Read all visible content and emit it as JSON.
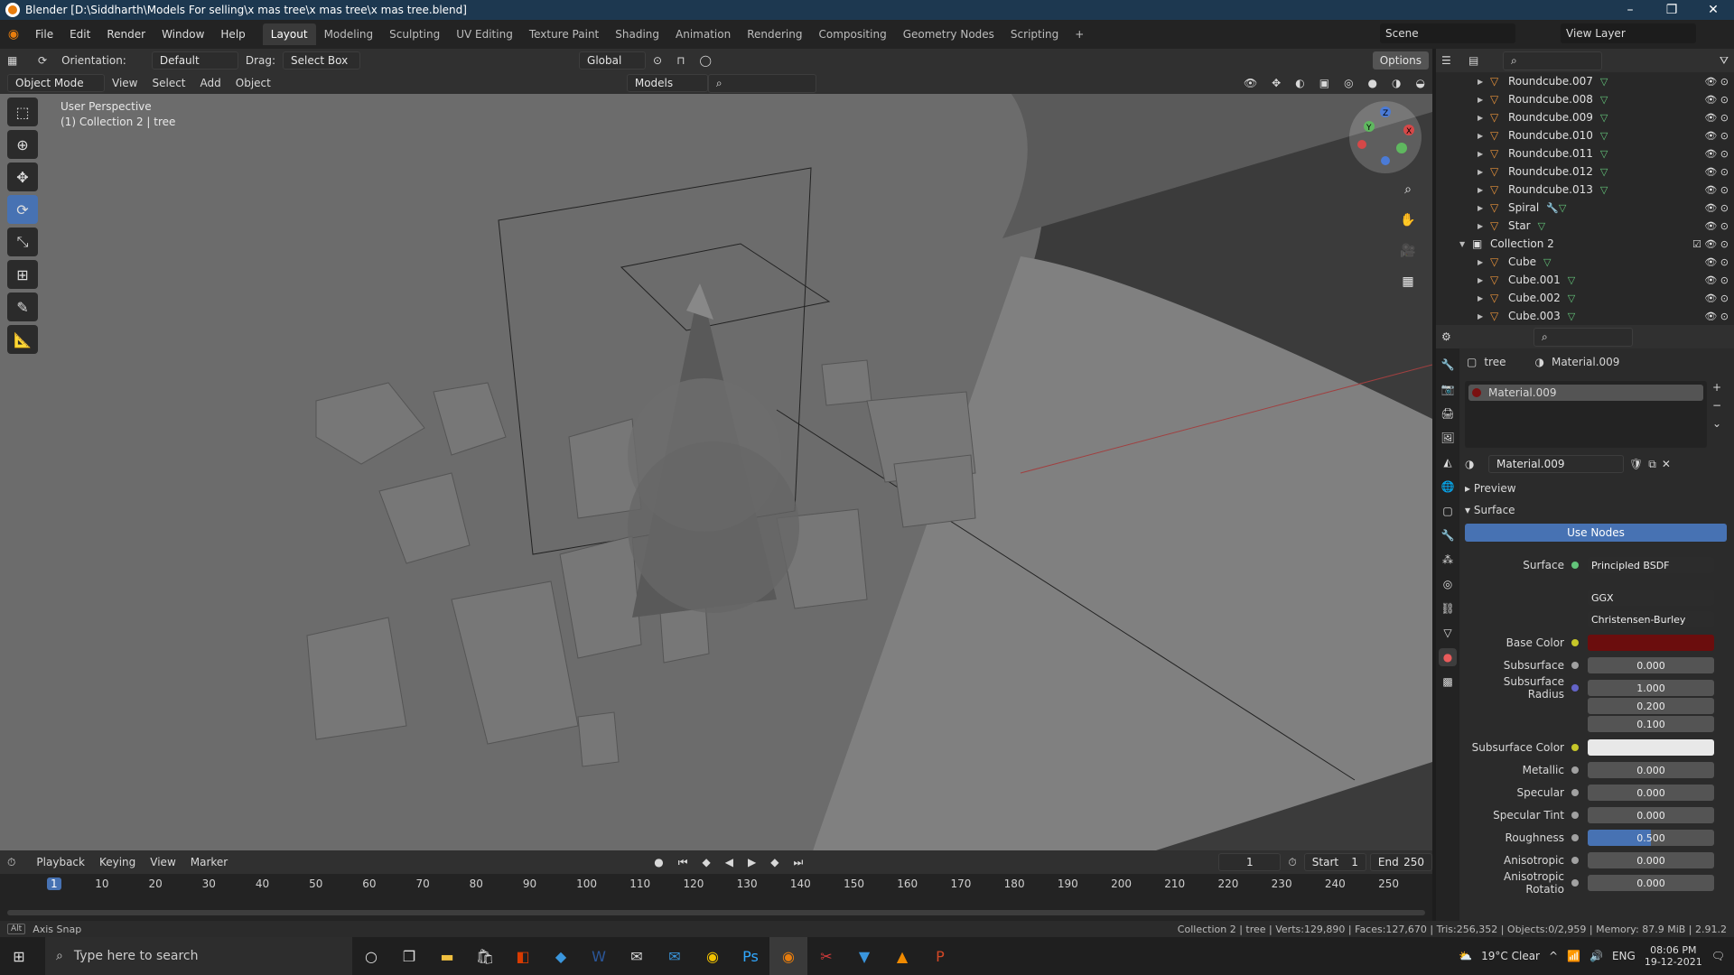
{
  "window": {
    "title": "Blender [D:\\Siddharth\\Models For selling\\x mas tree\\x mas tree\\x mas tree.blend]"
  },
  "menu": [
    "File",
    "Edit",
    "Render",
    "Window",
    "Help"
  ],
  "workspaces": [
    "Layout",
    "Modeling",
    "Sculpting",
    "UV Editing",
    "Texture Paint",
    "Shading",
    "Animation",
    "Rendering",
    "Compositing",
    "Geometry Nodes",
    "Scripting"
  ],
  "active_workspace": "Layout",
  "scene": {
    "label": "Scene",
    "view_layer": "View Layer"
  },
  "header": {
    "orientation_label": "Orientation:",
    "orientation_value": "Default",
    "drag_label": "Drag:",
    "drag_value": "Select Box",
    "transform_space": "Global",
    "options": "Options"
  },
  "header2": {
    "mode": "Object Mode",
    "view": "View",
    "select": "Select",
    "add": "Add",
    "object": "Object",
    "collection_filter": "Models"
  },
  "viewport": {
    "line1": "User Perspective",
    "line2": "(1) Collection 2 | tree"
  },
  "outliner": {
    "items": [
      {
        "name": "Roundcube.007"
      },
      {
        "name": "Roundcube.008"
      },
      {
        "name": "Roundcube.009"
      },
      {
        "name": "Roundcube.010"
      },
      {
        "name": "Roundcube.011"
      },
      {
        "name": "Roundcube.012"
      },
      {
        "name": "Roundcube.013"
      },
      {
        "name": "Spiral"
      },
      {
        "name": "Star"
      },
      {
        "name": "Collection 2"
      },
      {
        "name": "Cube"
      },
      {
        "name": "Cube.001"
      },
      {
        "name": "Cube.002"
      },
      {
        "name": "Cube.003"
      }
    ]
  },
  "properties": {
    "breadcrumb_object": "tree",
    "breadcrumb_material": "Material.009",
    "slot": "Material.009",
    "datablock": "Material.009",
    "preview": "Preview",
    "surface_panel": "Surface",
    "use_nodes": "Use Nodes",
    "surface_label": "Surface",
    "surface_value": "Principled BSDF",
    "distribution": "GGX",
    "subsurface_method": "Christensen-Burley",
    "fields": [
      {
        "label": "Base Color",
        "value": ""
      },
      {
        "label": "Subsurface",
        "value": "0.000"
      },
      {
        "label": "Subsurface Radius",
        "value": "1.000"
      },
      {
        "label": "",
        "value": "0.200"
      },
      {
        "label": "",
        "value": "0.100"
      },
      {
        "label": "Subsurface Color",
        "value": ""
      },
      {
        "label": "Metallic",
        "value": "0.000"
      },
      {
        "label": "Specular",
        "value": "0.000"
      },
      {
        "label": "Specular Tint",
        "value": "0.000"
      },
      {
        "label": "Roughness",
        "value": "0.500"
      },
      {
        "label": "Anisotropic",
        "value": "0.000"
      },
      {
        "label": "Anisotropic Rotatio",
        "value": "0.000"
      }
    ],
    "base_color": "#6b0d0d",
    "subsurface_color": "#e8e8e8",
    "roughness_fill": 0.5
  },
  "timeline": {
    "playback": "Playback",
    "keying": "Keying",
    "view": "View",
    "marker": "Marker",
    "current_frame": "1",
    "start_label": "Start",
    "start": "1",
    "end_label": "End",
    "end": "250",
    "ticks": [
      "1",
      "10",
      "20",
      "30",
      "40",
      "50",
      "60",
      "70",
      "80",
      "90",
      "100",
      "110",
      "120",
      "130",
      "140",
      "150",
      "160",
      "170",
      "180",
      "190",
      "200",
      "210",
      "220",
      "230",
      "240",
      "250"
    ]
  },
  "status": {
    "left_key": "Alt",
    "left": "Axis Snap",
    "right": "Collection 2 | tree | Verts:129,890 | Faces:127,670 | Tris:256,352 | Objects:0/2,959 | Memory: 87.9 MiB | 2.91.2"
  },
  "taskbar": {
    "search": "Type here to search",
    "weather": "19°C  Clear",
    "lang": "ENG",
    "time": "08:06 PM",
    "date": "19-12-2021"
  }
}
